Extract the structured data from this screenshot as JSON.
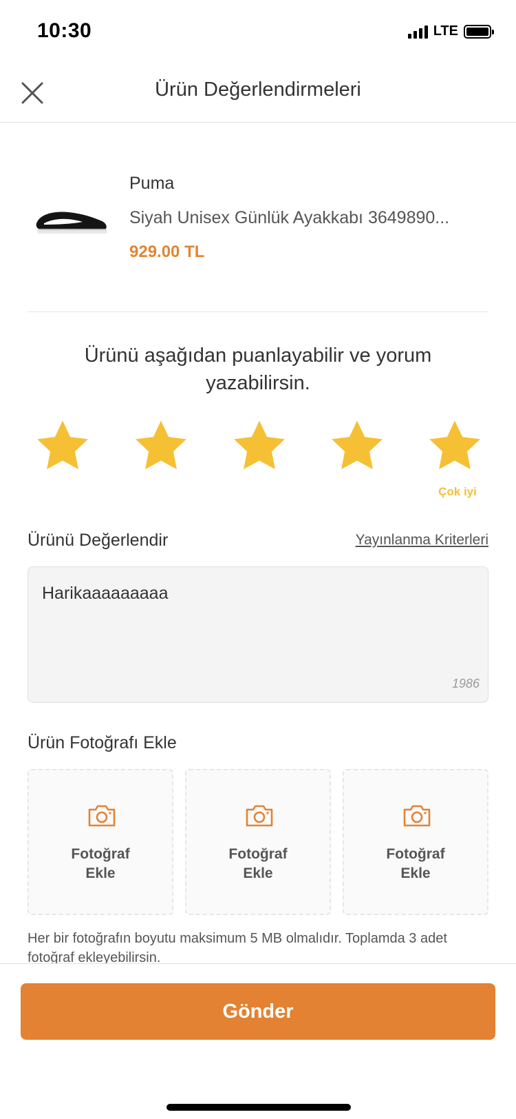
{
  "status_bar": {
    "time": "10:30",
    "network": "LTE"
  },
  "header": {
    "title": "Ürün Değerlendirmeleri"
  },
  "product": {
    "brand": "Puma",
    "name": "Siyah Unisex Günlük Ayakkabı 3649890...",
    "price": "929.00 TL"
  },
  "rating": {
    "prompt": "Ürünü aşağıdan puanlayabilir ve yorum yazabilirsin.",
    "value": 5,
    "max": 5,
    "label": "Çok iyi",
    "star_color": "#f6c035"
  },
  "review": {
    "section_label": "Ürünü Değerlendir",
    "criteria_link": "Yayınlanma Kriterleri",
    "text": "Harikaaaaaaaaa",
    "char_count": "1986"
  },
  "photos": {
    "section_label": "Ürün Fotoğrafı Ekle",
    "slots": [
      {
        "label_line1": "Fotoğraf",
        "label_line2": "Ekle"
      },
      {
        "label_line1": "Fotoğraf",
        "label_line2": "Ekle"
      },
      {
        "label_line1": "Fotoğraf",
        "label_line2": "Ekle"
      }
    ],
    "note": "Her bir fotoğrafın boyutu maksimum 5 MB olmalıdır. Toplamda 3 adet fotoğraf ekleyebilirsin."
  },
  "footer": {
    "send_label": "Gönder"
  },
  "colors": {
    "accent": "#e38232",
    "price": "#e28533"
  }
}
